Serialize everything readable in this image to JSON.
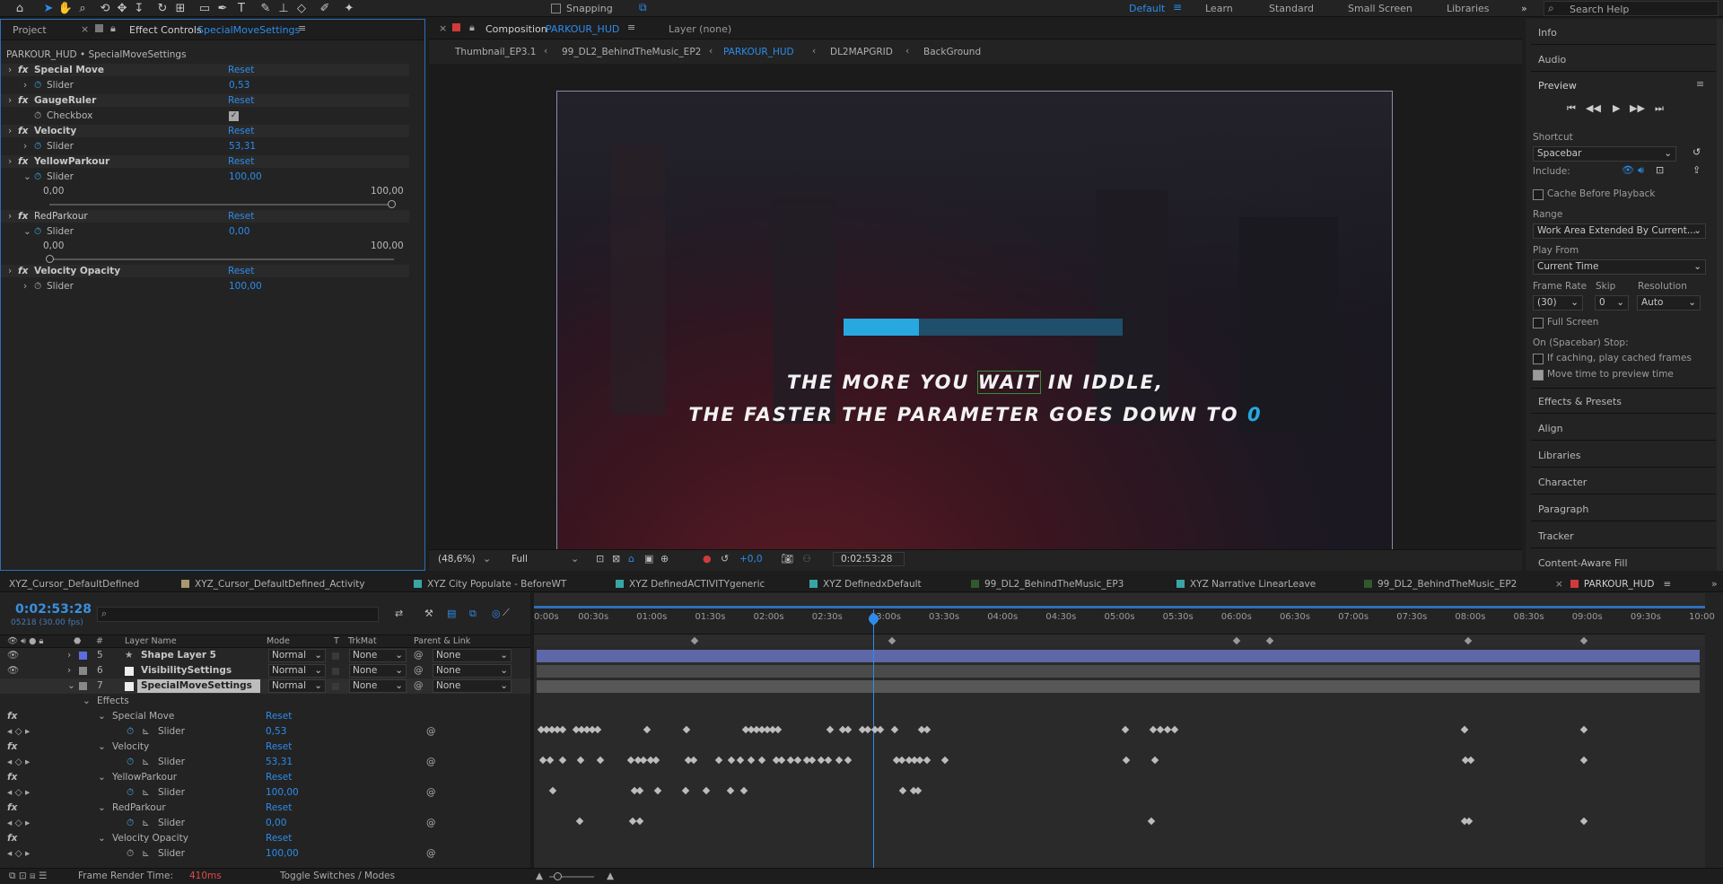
{
  "toolbar": {
    "workspaces": [
      "Default",
      "Learn",
      "Standard",
      "Small Screen",
      "Libraries"
    ],
    "active_workspace": "Default",
    "snapping_label": "Snapping",
    "search_placeholder": "Search Help"
  },
  "left_panel": {
    "tab_project": "Project",
    "tab_effect_controls": "Effect Controls",
    "effect_layer": "SpecialMoveSettings",
    "breadcrumb": "PARKOUR_HUD • SpecialMoveSettings",
    "effects": [
      {
        "name": "Special Move",
        "reset": "Reset",
        "param": "Slider",
        "value": "0,53"
      },
      {
        "name": "GaugeRuler",
        "reset": "Reset",
        "param": "Checkbox",
        "value": ""
      },
      {
        "name": "Velocity",
        "reset": "Reset",
        "param": "Slider",
        "value": "53,31"
      },
      {
        "name": "YellowParkour",
        "reset": "Reset",
        "param": "Slider",
        "value": "100,00",
        "min": "0,00",
        "max": "100,00"
      },
      {
        "name": "RedParkour",
        "reset": "Reset",
        "param": "Slider",
        "value": "0,00",
        "min": "0,00",
        "max": "100,00"
      },
      {
        "name": "Velocity Opacity",
        "reset": "Reset",
        "param": "Slider",
        "value": "100,00"
      }
    ]
  },
  "composition": {
    "tab_label": "Composition",
    "tab_name": "PARKOUR_HUD",
    "layer_label": "Layer (none)",
    "flow": [
      "Thumbnail_EP3.1",
      "99_DL2_BehindTheMusic_EP2",
      "PARKOUR_HUD",
      "DL2MAPGRID",
      "BackGround"
    ],
    "caption_line1_a": "THE MORE YOU ",
    "caption_line1_b": "WAIT",
    "caption_line1_c": " IN IDDLE,",
    "caption_line2_a": "THE FASTER THE PARAMETER GOES DOWN TO ",
    "caption_line2_b": "0",
    "progress_value": 0.27,
    "zoom": "(48,6%)",
    "resolution": "Full",
    "exposure": "+0,0",
    "timecode": "0:02:53:28"
  },
  "right_panel": {
    "info": "Info",
    "audio": "Audio",
    "preview": "Preview",
    "shortcut_label": "Shortcut",
    "shortcut_value": "Spacebar",
    "include_label": "Include:",
    "cache_label": "Cache Before Playback",
    "range_label": "Range",
    "range_value": "Work Area Extended By Current...",
    "play_from_label": "Play From",
    "play_from_value": "Current Time",
    "frame_rate_label": "Frame Rate",
    "skip_label": "Skip",
    "resolution_label": "Resolution",
    "frame_rate_value": "(30)",
    "skip_value": "0",
    "resolution_value": "Auto",
    "full_screen": "Full Screen",
    "stop_label": "On (Spacebar) Stop:",
    "if_caching": "If caching, play cached frames",
    "move_time": "Move time to preview time",
    "panels": [
      "Effects & Presets",
      "Align",
      "Libraries",
      "Character",
      "Paragraph",
      "Tracker",
      "Content-Aware Fill"
    ]
  },
  "timeline": {
    "tabs": [
      {
        "name": "XYZ_Cursor_DefaultDefined",
        "color": "#555555"
      },
      {
        "name": "XYZ_Cursor_DefaultDefined_Activity",
        "color": "#a89970"
      },
      {
        "name": "XYZ City Populate - BeforeWT",
        "color": "#3aa5a5"
      },
      {
        "name": "XYZ DefinedACTIVITYgeneric",
        "color": "#3aa5a5"
      },
      {
        "name": "XYZ DefinedxDefault",
        "color": "#3aa5a5"
      },
      {
        "name": "99_DL2_BehindTheMusic_EP3",
        "color": "#2e5a2e"
      },
      {
        "name": "XYZ Narrative LinearLeave",
        "color": "#3aa5a5"
      },
      {
        "name": "99_DL2_BehindTheMusic_EP2",
        "color": "#2e5a2e"
      },
      {
        "name": "PARKOUR_HUD",
        "color": "#d23a3a"
      }
    ],
    "timecode": "0:02:53:28",
    "frames": "05218 (30.00 fps)",
    "ruler": [
      "0:00s",
      "00:30s",
      "01:00s",
      "01:30s",
      "02:00s",
      "02:30s",
      "03:00s",
      "03:30s",
      "04:00s",
      "04:30s",
      "05:00s",
      "05:30s",
      "06:00s",
      "06:30s",
      "07:00s",
      "07:30s",
      "08:00s",
      "08:30s",
      "09:00s",
      "09:30s",
      "10:00"
    ],
    "columns": {
      "layer_name": "Layer Name",
      "mode": "Mode",
      "t": "T",
      "trkmat": "TrkMat",
      "parent": "Parent & Link"
    },
    "layers": [
      {
        "num": "5",
        "name": "Shape Layer 5",
        "mode": "Normal",
        "trkmat": "None",
        "parent": "None"
      },
      {
        "num": "6",
        "name": "VisibilitySettings",
        "mode": "Normal",
        "trkmat": "None",
        "parent": "None"
      },
      {
        "num": "7",
        "name": "SpecialMoveSettings",
        "mode": "Normal",
        "trkmat": "None",
        "parent": "None"
      }
    ],
    "effects_label": "Effects",
    "props": [
      {
        "group": "Special Move",
        "reset": "Reset",
        "param": "Slider",
        "value": "0,53"
      },
      {
        "group": "Velocity",
        "reset": "Reset",
        "param": "Slider",
        "value": "53,31"
      },
      {
        "group": "YellowParkour",
        "reset": "Reset",
        "param": "Slider",
        "value": "100,00"
      },
      {
        "group": "RedParkour",
        "reset": "Reset",
        "param": "Slider",
        "value": "0,00"
      },
      {
        "group": "Velocity Opacity",
        "reset": "Reset",
        "param": "Slider",
        "value": "100,00"
      }
    ],
    "footer_render_label": "Frame Render Time:",
    "footer_render_value": "410ms",
    "footer_toggle": "Toggle Switches / Modes"
  }
}
